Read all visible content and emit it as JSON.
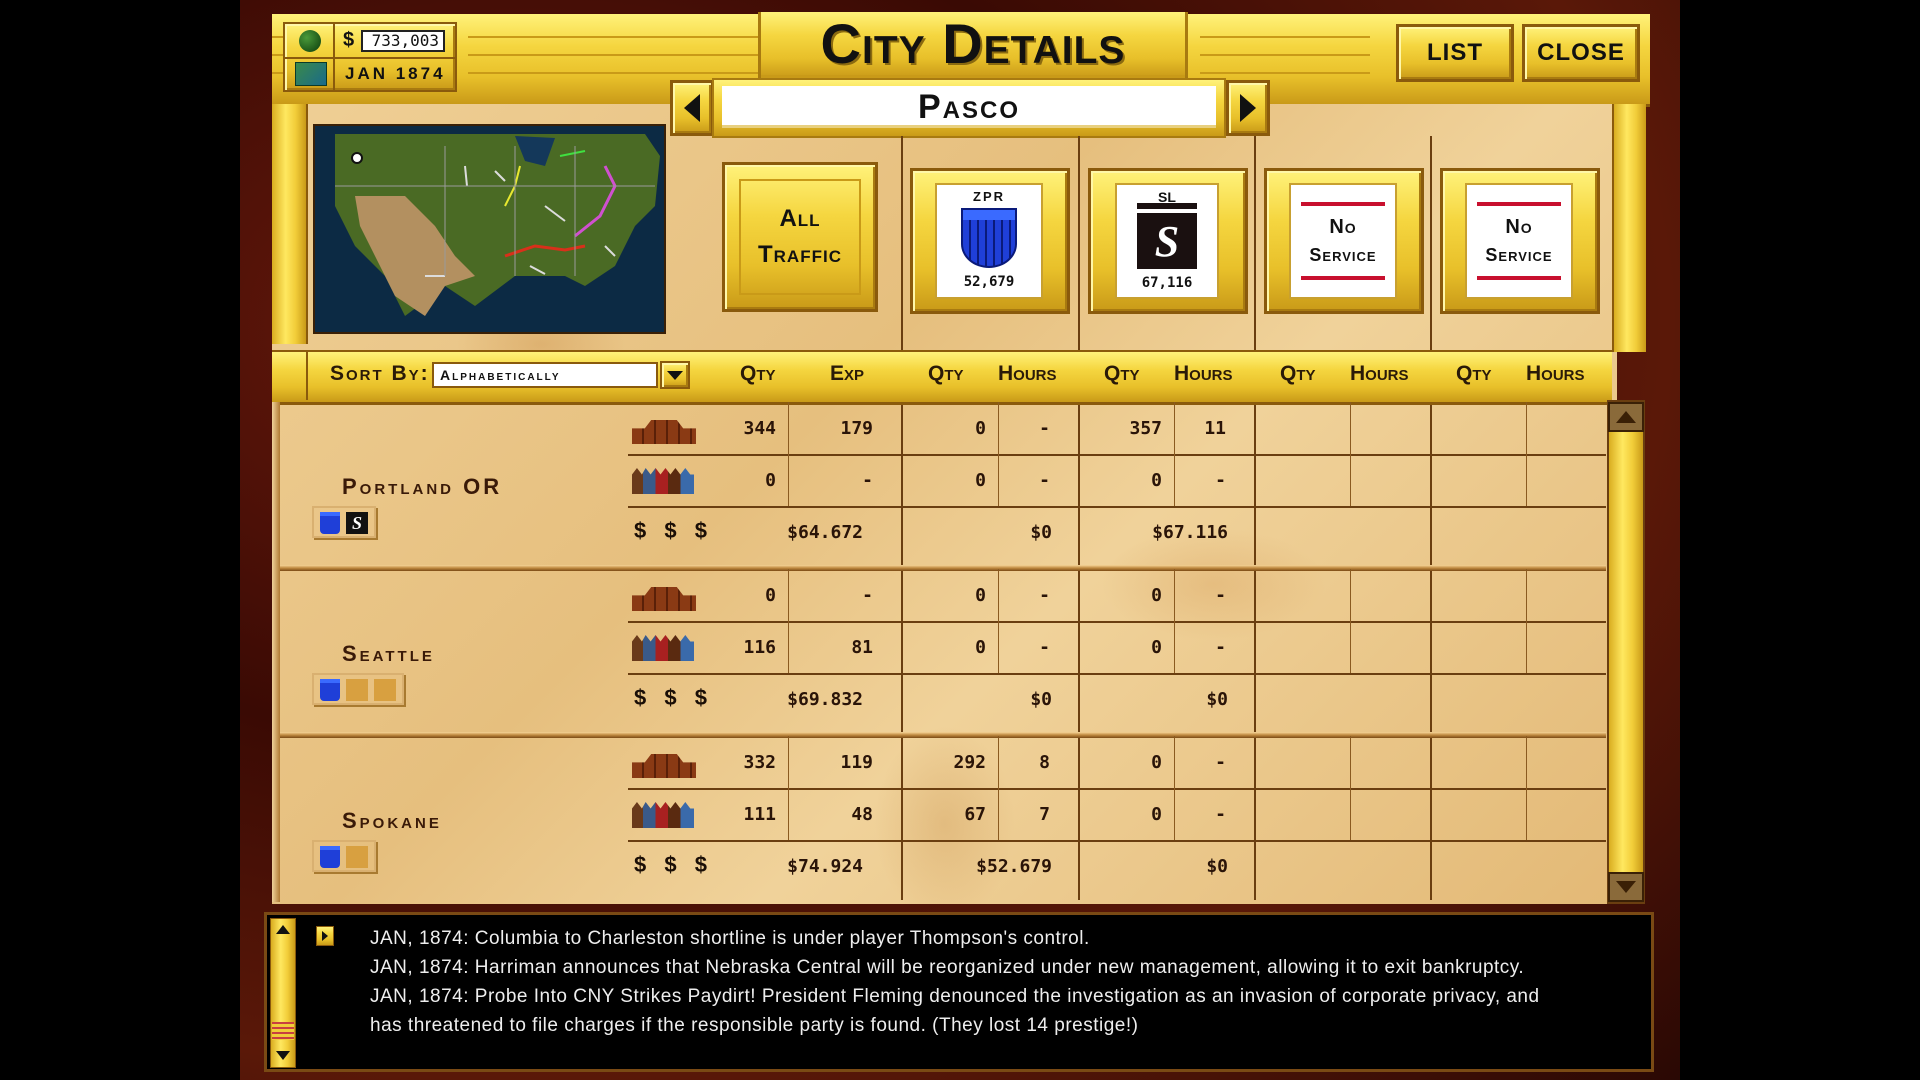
{
  "window": {
    "title": "City Details"
  },
  "status": {
    "money_symbol": "$",
    "money": "733,003",
    "date": "JAN 1874",
    "globe_icon": "green-globe-icon",
    "map_icon": "mini-map-icon"
  },
  "buttons": {
    "list": "LIST",
    "close": "CLOSE"
  },
  "city_nav": {
    "prev_icon": "triangle-left-icon",
    "next_icon": "triangle-right-icon",
    "city_name": "Pasco"
  },
  "railroads": [
    {
      "id": "all",
      "label_line1": "All",
      "label_line2": "Traffic"
    },
    {
      "id": "zpr",
      "abbr": "ZPR",
      "value": "52,679",
      "logo_color": "#1f3fd8"
    },
    {
      "id": "sl",
      "abbr": "SL",
      "value": "67,116",
      "logo_color": "#111111"
    },
    {
      "id": "none1",
      "label_line1": "No",
      "label_line2": "Service",
      "accent": "#c8102e"
    },
    {
      "id": "none2",
      "label_line1": "No",
      "label_line2": "Service",
      "accent": "#c8102e"
    }
  ],
  "sort": {
    "label": "Sort By:",
    "value": "Alphabetically"
  },
  "columns": {
    "all": [
      "Qty",
      "Exp"
    ],
    "zpr": [
      "Qty",
      "Hours"
    ],
    "sl": [
      "Qty",
      "Hours"
    ],
    "none1": [
      "Qty",
      "Hours"
    ],
    "none2": [
      "Qty",
      "Hours"
    ]
  },
  "row_labels": {
    "freight_icon": "freight-crates-icon",
    "passenger_icon": "passengers-icon",
    "money": "$ $ $"
  },
  "cities": [
    {
      "name": "Portland OR",
      "served_by": [
        "zpr",
        "sl"
      ],
      "freight": {
        "all_qty": "344",
        "all_exp": "179",
        "zpr_qty": "0",
        "zpr_hours": "-",
        "sl_qty": "357",
        "sl_hours": "11"
      },
      "passengers": {
        "all_qty": "0",
        "all_exp": "-",
        "zpr_qty": "0",
        "zpr_hours": "-",
        "sl_qty": "0",
        "sl_hours": "-"
      },
      "money": {
        "all": "$64.672",
        "zpr": "$0",
        "sl": "$67.116"
      }
    },
    {
      "name": "Seattle",
      "served_by": [
        "zpr",
        "empty",
        "empty"
      ],
      "freight": {
        "all_qty": "0",
        "all_exp": "-",
        "zpr_qty": "0",
        "zpr_hours": "-",
        "sl_qty": "0",
        "sl_hours": "-"
      },
      "passengers": {
        "all_qty": "116",
        "all_exp": "81",
        "zpr_qty": "0",
        "zpr_hours": "-",
        "sl_qty": "0",
        "sl_hours": "-"
      },
      "money": {
        "all": "$69.832",
        "zpr": "$0",
        "sl": "$0"
      }
    },
    {
      "name": "Spokane",
      "served_by": [
        "zpr",
        "empty"
      ],
      "freight": {
        "all_qty": "332",
        "all_exp": "119",
        "zpr_qty": "292",
        "zpr_hours": "8",
        "sl_qty": "0",
        "sl_hours": "-"
      },
      "passengers": {
        "all_qty": "111",
        "all_exp": "48",
        "zpr_qty": "67",
        "zpr_hours": "7",
        "sl_qty": "0",
        "sl_hours": "-"
      },
      "money": {
        "all": "$74.924",
        "zpr": "$52.679",
        "sl": "$0"
      }
    }
  ],
  "news": [
    "JAN, 1874: Columbia to Charleston shortline is under player Thompson's control.",
    "JAN, 1874: Harriman announces that Nebraska Central will be reorganized under new management, allowing it to exit bankruptcy.",
    "JAN, 1874: Probe Into CNY Strikes Paydirt! President Fleming denounced the investigation as an invasion of corporate privacy, and has threatened to file charges if the responsible party is found. (They lost 14 prestige!)"
  ]
}
